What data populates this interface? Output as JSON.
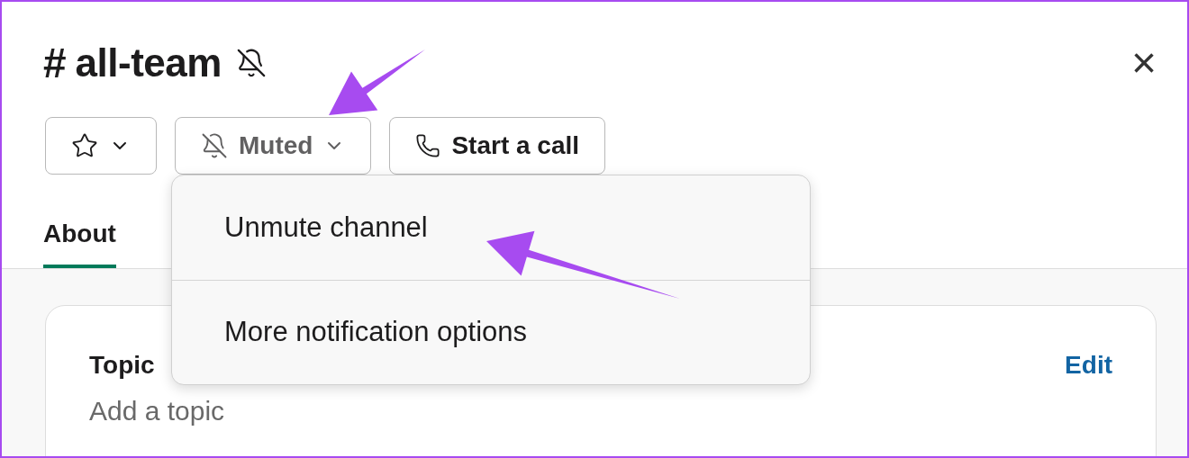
{
  "header": {
    "prefix": "#",
    "title": "all-team",
    "muted": true,
    "close_label": "×"
  },
  "toolbar": [
    {
      "kind": "star"
    },
    {
      "kind": "mute",
      "label": "Muted"
    },
    {
      "kind": "call",
      "label": "Start a call"
    }
  ],
  "tabs": [
    {
      "label": "About",
      "selected": true
    }
  ],
  "menu": {
    "items": [
      {
        "label": "Unmute channel"
      },
      {
        "label": "More notification options"
      }
    ]
  },
  "card": {
    "title": "Topic",
    "action": "Edit",
    "placeholder": "Add a topic"
  }
}
